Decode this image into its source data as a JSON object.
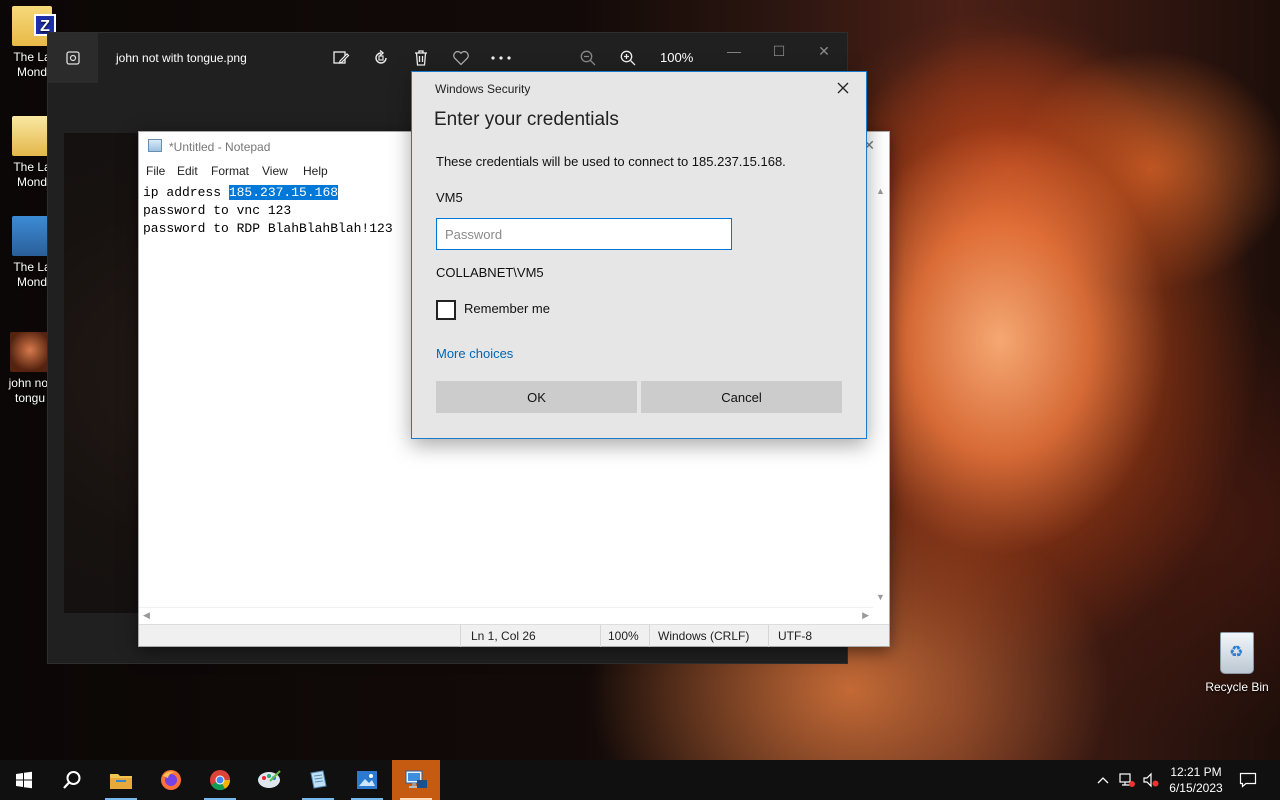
{
  "desktop": {
    "icons": [
      {
        "label_line1": "The La",
        "label_line2": "Mond"
      },
      {
        "label_line1": "The La",
        "label_line2": "Mond"
      },
      {
        "label_line1": "The La",
        "label_line2": "Mond"
      },
      {
        "label_line1": "john not",
        "label_line2": "tongu"
      }
    ],
    "recycle_bin_label": "Recycle Bin",
    "zip_badge": "Z"
  },
  "photos": {
    "title": "john not with tongue.png",
    "zoom": "100%",
    "toolbar_icons": [
      "edit-image-icon",
      "rotate-icon",
      "delete-icon",
      "favorite-icon",
      "more-icon",
      "zoom-out-icon",
      "zoom-in-icon"
    ]
  },
  "notepad": {
    "title": "*Untitled - Notepad",
    "menu": [
      "File",
      "Edit",
      "Format",
      "View",
      "Help"
    ],
    "lines": [
      {
        "prefix": "ip address ",
        "selected": "185.237.15.168"
      },
      {
        "text": "password to vnc 123"
      },
      {
        "text": "password to RDP BlahBlahBlah!123"
      }
    ],
    "status": {
      "position": "Ln 1, Col 26",
      "zoom": "100%",
      "line_endings": "Windows (CRLF)",
      "encoding": "UTF-8"
    }
  },
  "dialog": {
    "window_title": "Windows Security",
    "heading": "Enter your credentials",
    "description": "These credentials will be used to connect to 185.237.15.168.",
    "username": "VM5",
    "password_placeholder": "Password",
    "password_value": "",
    "domain_user": "COLLABNET\\VM5",
    "remember_label": "Remember me",
    "remember_checked": false,
    "more_choices": "More choices",
    "ok_label": "OK",
    "cancel_label": "Cancel",
    "accent_color": "#0078d7"
  },
  "taskbar": {
    "apps": [
      "start-icon",
      "search-icon",
      "file-explorer-icon",
      "firefox-icon",
      "chrome-icon",
      "paint-icon",
      "notepad-icon",
      "photos-icon",
      "remote-desktop-icon"
    ],
    "time": "12:21 PM",
    "date": "6/15/2023"
  }
}
